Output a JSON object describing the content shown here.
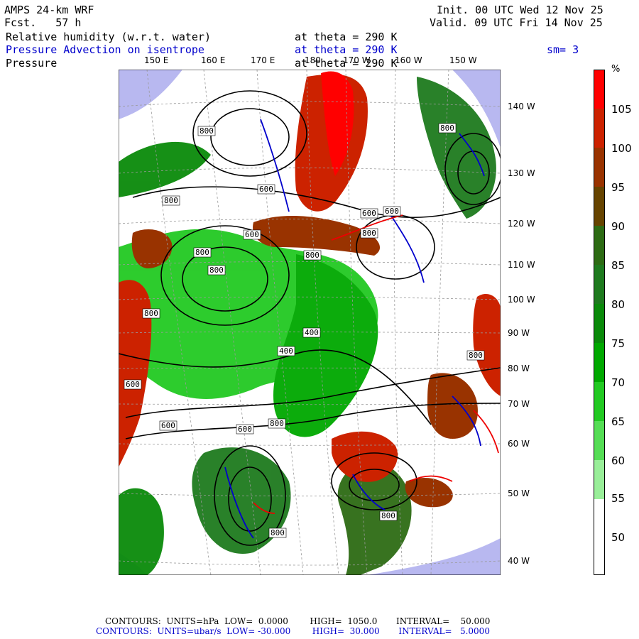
{
  "header": {
    "model": "AMPS 24-km WRF",
    "fcst": "Fcst.   57 h",
    "init": "Init. 00 UTC Wed 12 Nov 25",
    "valid": "Valid. 09 UTC Fri 14 Nov 25",
    "field1": "Relative humidity (w.r.t. water)",
    "field1_level": "at theta = 290 K",
    "field2": "Pressure Advection on isentrope",
    "field2_level": "at theta = 290 K",
    "smoothing": "sm= 3",
    "field3": "Pressure",
    "field3_level": "at theta = 290 K"
  },
  "lon_labels_top": [
    "150 E",
    "160 E",
    "170 E",
    "180",
    "170 W",
    "160 W",
    "150 W"
  ],
  "lon_labels_right": [
    "140 W",
    "130 W",
    "120 W",
    "110 W",
    "100 W",
    "90 W",
    "80 W",
    "70 W",
    "60 W",
    "50 W",
    "40 W"
  ],
  "contour_labels": [
    "800",
    "800",
    "600",
    "600",
    "800",
    "800",
    "800",
    "600",
    "600",
    "800",
    "400",
    "400",
    "800",
    "600",
    "600",
    "600",
    "800",
    "800",
    "800",
    "800",
    "800"
  ],
  "colorbar": {
    "unit": "%",
    "labels": [
      "105",
      "100",
      "95",
      "90",
      "85",
      "80",
      "75",
      "70",
      "65",
      "60",
      "55",
      "50"
    ],
    "colors": [
      "#ff0000",
      "#cc2200",
      "#993300",
      "#664400",
      "#2d6b14",
      "#1e7a1e",
      "#0a8a0a",
      "#00a800",
      "#22c922",
      "#55dd55",
      "#99ee99",
      "#ffffff",
      "#ffffff"
    ]
  },
  "colors": {
    "land": "#b8b8f0",
    "contour": "#000000",
    "advection": "#0000cc",
    "advection_pos": "#ee0000"
  },
  "footer": {
    "line1": "CONTOURS:  UNITS=hPa  LOW=  0.0000        HIGH=  1050.0       INTERVAL=    50.000",
    "line2": "CONTOURS:  UNITS=ubar/s  LOW= -30.000        HIGH=  30.000       INTERVAL=   5.0000"
  }
}
